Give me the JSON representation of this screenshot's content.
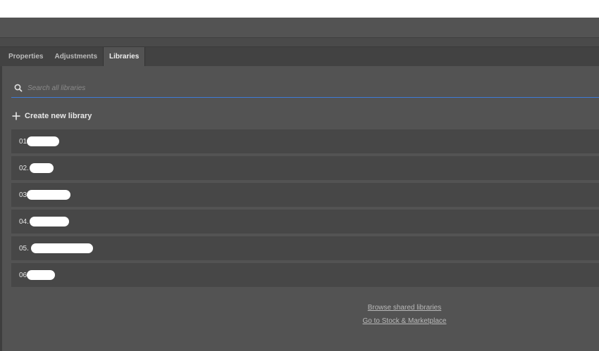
{
  "tabs": [
    {
      "label": "Properties",
      "active": false
    },
    {
      "label": "Adjustments",
      "active": false
    },
    {
      "label": "Libraries",
      "active": true
    }
  ],
  "search": {
    "placeholder": "Search all libraries",
    "value": ""
  },
  "create_label": "Create new library",
  "libraries": [
    {
      "prefix": "01"
    },
    {
      "prefix": "02."
    },
    {
      "prefix": "03"
    },
    {
      "prefix": "04."
    },
    {
      "prefix": "05."
    },
    {
      "prefix": "06"
    }
  ],
  "links": {
    "browse_shared": "Browse shared libraries",
    "stock": "Go to Stock & Marketplace"
  },
  "colors": {
    "panel_bg": "#535353",
    "item_bg": "#474747",
    "search_underline": "#3d7bd8"
  },
  "icons": {
    "search": "search-icon",
    "create": "plus-icon"
  }
}
